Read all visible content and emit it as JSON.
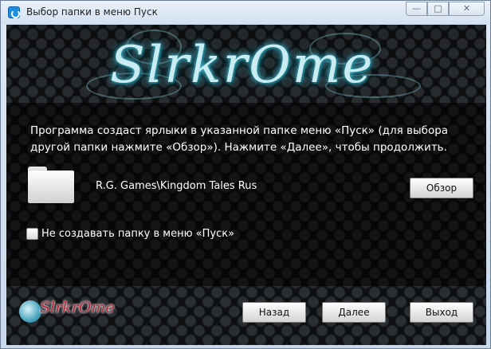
{
  "window": {
    "title": "Выбор папки в меню Пуск",
    "minimize_glyph": "—",
    "maximize_glyph": "□",
    "close_glyph": "✕"
  },
  "banner": {
    "logo_text": "SlrkrOme",
    "accent_color": "#4fd0e6"
  },
  "content": {
    "description": "Программа создаст ярлыки в указанной папке меню «Пуск» (для выбора другой папки нажмите «Обзор»). Нажмите «Далее», чтобы продолжить.",
    "folder_icon": "folder-icon",
    "folder_path": "R.G. Games\\Kingdom Tales Rus",
    "browse_label": "Обзор",
    "checkbox_label": "Не создавать папку в меню «Пуск»",
    "checkbox_checked": false
  },
  "footer": {
    "brand_text": "SlrkrOme",
    "back_label": "Назад",
    "next_label": "Далее",
    "exit_label": "Выход"
  }
}
